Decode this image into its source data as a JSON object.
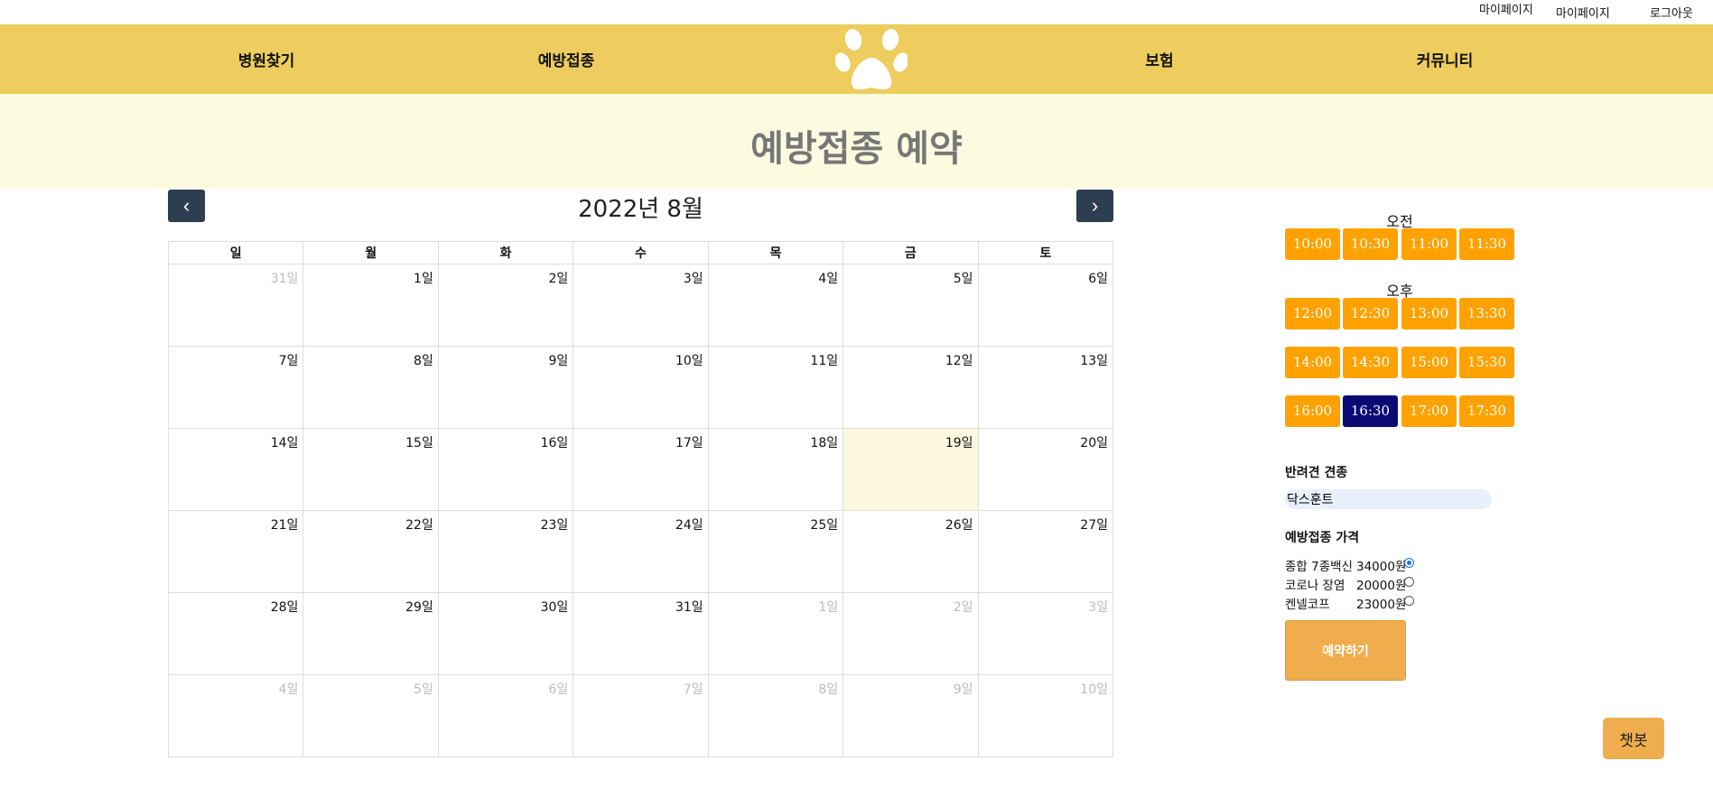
{
  "topbar": {
    "mypage_small": "마이페이지",
    "mypage": "마이페이지",
    "logout": "로그아웃"
  },
  "nav": {
    "hospital": "병원찾기",
    "vaccination": "예방접종",
    "insurance": "보험",
    "community": "커뮤니티",
    "logo_icon": "paw-icon"
  },
  "colors": {
    "nav_bg": "#eecd5e",
    "banner_bg": "#fcfbe0",
    "slot": "#ffa200",
    "slot_selected": "#0b0a75",
    "reserve": "#f0ad4e",
    "today": "#fcf8e0"
  },
  "page": {
    "title": "예방접종 예약"
  },
  "calendar": {
    "prev_icon": "chevron-left-icon",
    "next_icon": "chevron-right-icon",
    "month_title": "2022년 8월",
    "weekdays": [
      "일",
      "월",
      "화",
      "수",
      "목",
      "금",
      "토"
    ],
    "weeks": [
      [
        "31일",
        "1일",
        "2일",
        "3일",
        "4일",
        "5일",
        "6일"
      ],
      [
        "7일",
        "8일",
        "9일",
        "10일",
        "11일",
        "12일",
        "13일"
      ],
      [
        "14일",
        "15일",
        "16일",
        "17일",
        "18일",
        "19일",
        "20일"
      ],
      [
        "21일",
        "22일",
        "23일",
        "24일",
        "25일",
        "26일",
        "27일"
      ],
      [
        "28일",
        "29일",
        "30일",
        "31일",
        "1일",
        "2일",
        "3일"
      ],
      [
        "4일",
        "5일",
        "6일",
        "7일",
        "8일",
        "9일",
        "10일"
      ]
    ],
    "today": "19일"
  },
  "times": {
    "morning_label": "오전",
    "afternoon_label": "오후",
    "morning": [
      "10:00",
      "10:30",
      "11:00",
      "11:30"
    ],
    "afternoon_1": [
      "12:00",
      "12:30",
      "13:00",
      "13:30"
    ],
    "afternoon_2": [
      "14:00",
      "14:30",
      "15:00",
      "15:30"
    ],
    "afternoon_3": [
      "16:00",
      "16:30",
      "17:00",
      "17:30"
    ],
    "selected": "16:30"
  },
  "form": {
    "breed_label": "반려견 견종",
    "breed_value": "닥스훈트",
    "price_label": "예방접종 가격",
    "prices": [
      {
        "name": "종합 7종백신",
        "price": "34000원",
        "checked": true
      },
      {
        "name": "코로나 장염",
        "price": "20000원",
        "checked": false
      },
      {
        "name": "켄넬코프",
        "price": "23000원",
        "checked": false
      }
    ],
    "reserve_button": "예약하기"
  },
  "chatbot": {
    "label": "챗봇"
  }
}
